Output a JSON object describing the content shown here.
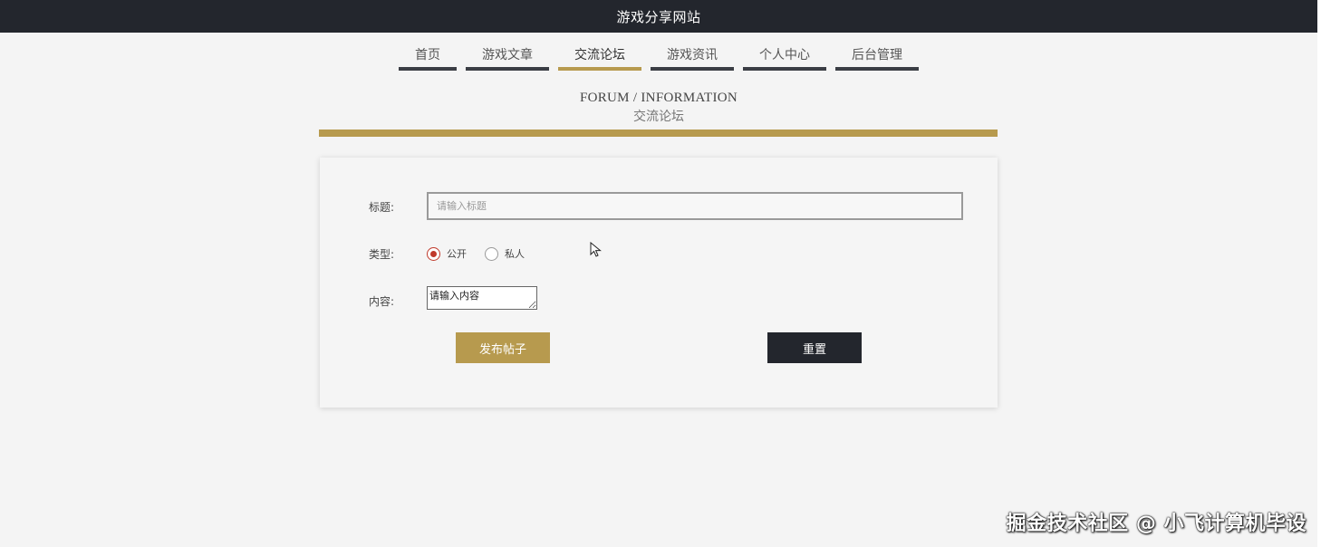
{
  "header": {
    "site_title": "游戏分享网站"
  },
  "nav": {
    "items": [
      {
        "label": "首页"
      },
      {
        "label": "游戏文章"
      },
      {
        "label": "交流论坛"
      },
      {
        "label": "游戏资讯"
      },
      {
        "label": "个人中心"
      },
      {
        "label": "后台管理"
      }
    ],
    "active_index": 2
  },
  "heading": {
    "en": "FORUM / INFORMATION",
    "cn": "交流论坛"
  },
  "form": {
    "title_label": "标题:",
    "title_placeholder": "请输入标题",
    "type_label": "类型:",
    "type_options": [
      {
        "label": "公开",
        "checked": true
      },
      {
        "label": "私人",
        "checked": false
      }
    ],
    "content_label": "内容:",
    "content_value": "请输入内容",
    "submit_label": "发布帖子",
    "reset_label": "重置"
  },
  "watermark": "掘金技术社区 @ 小飞计算机毕设",
  "colors": {
    "topbar": "#23262d",
    "accent_gold": "#b79a4e",
    "radio_checked": "#c0392b"
  },
  "icons": {
    "cursor": "mouse-pointer-icon"
  }
}
